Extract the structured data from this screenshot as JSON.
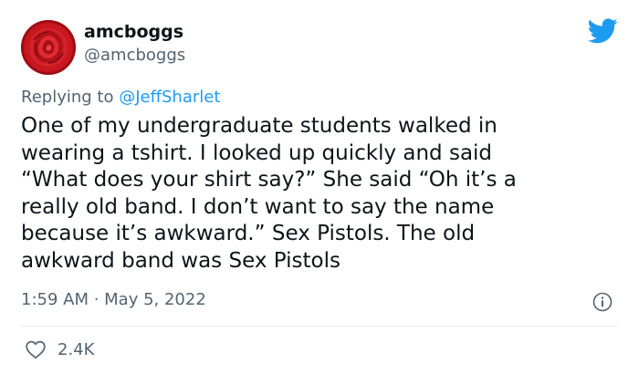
{
  "user": {
    "display_name": "amcboggs",
    "handle": "@amcboggs",
    "avatar_icon": "red-rose-avatar",
    "brand_icon": "twitter-bird-icon"
  },
  "reply": {
    "prefix": "Replying to ",
    "mention": "@JeffSharlet"
  },
  "tweet": {
    "lines": [
      "One of my undergraduate students walked in",
      "wearing a tshirt. I looked up quickly and said",
      "“What does your shirt say?” She said “Oh it’s a",
      "really old band. I don’t want to say the name",
      "because it’s awkward.” Sex Pistols. The old",
      "awkward band was Sex Pistols"
    ],
    "timestamp": "1:59 AM · May 5, 2022",
    "info_icon": "info-icon"
  },
  "actions": {
    "like_icon": "heart-icon",
    "like_count": "2.4K"
  },
  "colors": {
    "text": "#0f1419",
    "muted": "#536471",
    "accent": "#1d9bf0",
    "divider": "#e1e8ed"
  }
}
